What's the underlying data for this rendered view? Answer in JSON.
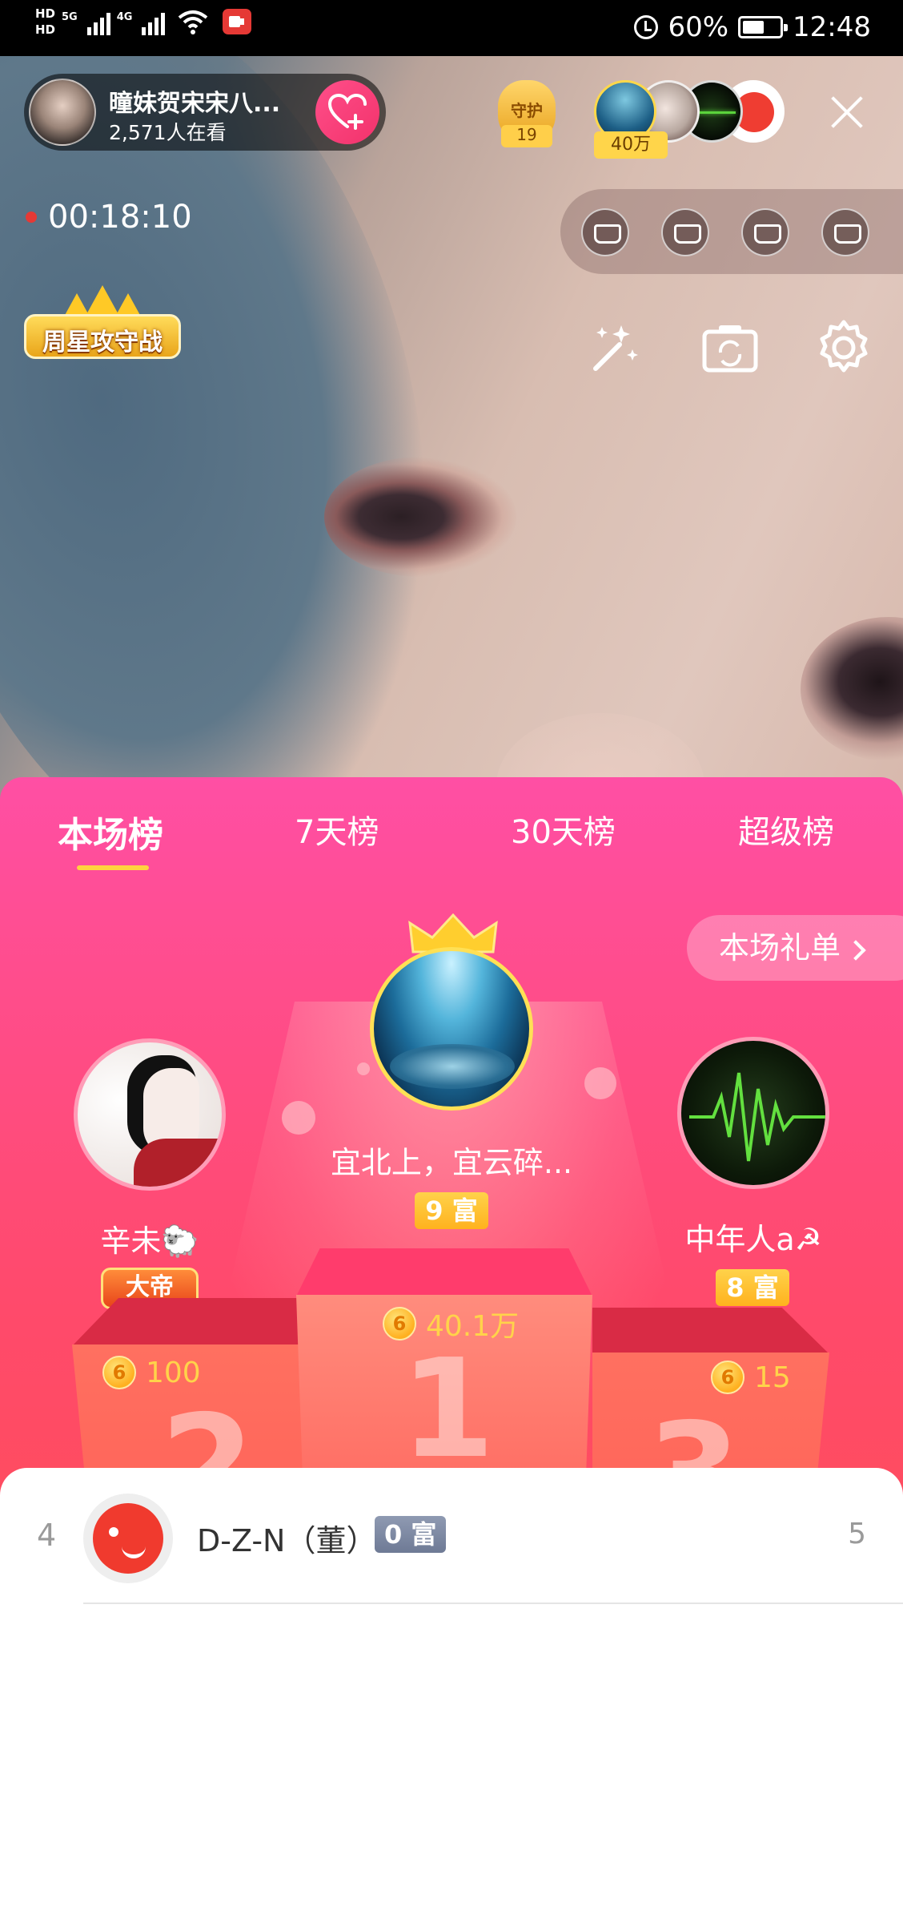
{
  "status_bar": {
    "hd1": "HD",
    "hd2": "HD",
    "net1": "5G",
    "net2": "4G",
    "battery_percent": "60%",
    "battery_level": 0.6,
    "time": "12:48",
    "icons": [
      "signal-icon",
      "wifi-icon",
      "screen-record-icon",
      "alarm-icon",
      "battery-icon"
    ]
  },
  "live": {
    "host_name": "曈妹贺宋宋八...",
    "viewers": "2,571人在看",
    "guard_label": "守护",
    "guard_count": "19",
    "top_fan_value": "40万",
    "timer": "00:18:10",
    "weekly_badge": "周星攻守战"
  },
  "ranking": {
    "tabs": [
      {
        "label": "本场榜",
        "active": true
      },
      {
        "label": "7天榜",
        "active": false
      },
      {
        "label": "30天榜",
        "active": false
      },
      {
        "label": "超级榜",
        "active": false
      }
    ],
    "gift_list_button": "本场礼单",
    "first": {
      "rank": "1",
      "name": "宜北上，宜云碎...",
      "badge": "9 富",
      "coins": "40.1万"
    },
    "second": {
      "rank": "2",
      "name": "辛未🐑",
      "title_badge": "大帝",
      "coins": "100"
    },
    "third": {
      "rank": "3",
      "name": "中年人a☭",
      "badge": "8 富",
      "coins": "15"
    },
    "coin_symbol": "6",
    "list": [
      {
        "rank": "4",
        "name": "D-Z-N（董）",
        "badge": "0 富",
        "value": "5"
      }
    ]
  },
  "colors": {
    "accent_pink": "#ff4fa4",
    "accent_red": "#ff4d58",
    "gold": "#ffd34a",
    "tab_underline": "#ffd23f"
  }
}
